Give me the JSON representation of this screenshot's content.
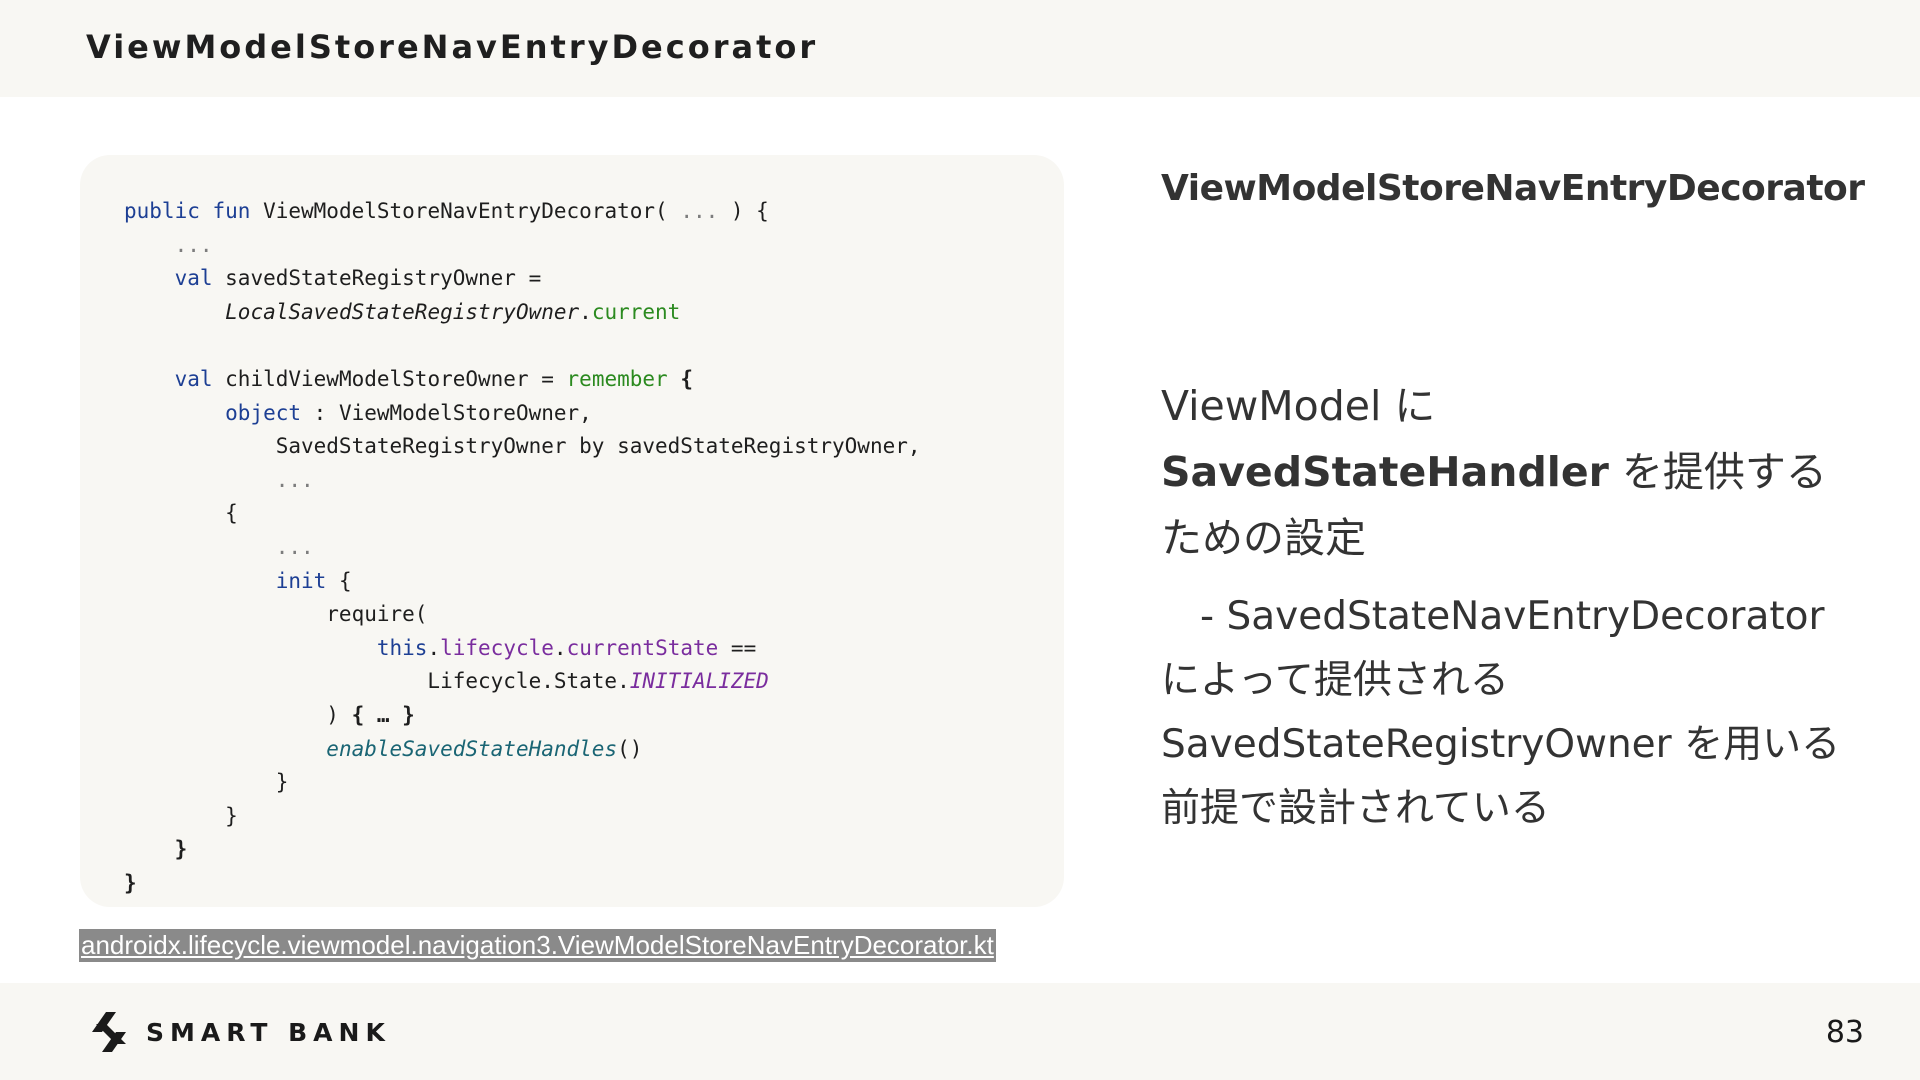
{
  "header": {
    "title": "ViewModelStoreNavEntryDecorator"
  },
  "code": {
    "lines": [
      [
        {
          "t": "public fun",
          "c": "kw"
        },
        {
          "t": " ViewModelStoreNavEntryDecorator( "
        },
        {
          "t": "...",
          "c": "gray"
        },
        {
          "t": " ) {"
        }
      ],
      [
        {
          "t": "    "
        },
        {
          "t": "...",
          "c": "gray"
        }
      ],
      [
        {
          "t": "    "
        },
        {
          "t": "val",
          "c": "kw"
        },
        {
          "t": " savedStateRegistryOwner ="
        }
      ],
      [
        {
          "t": "        "
        },
        {
          "t": "LocalSavedStateRegistryOwner",
          "c": "italic"
        },
        {
          "t": "."
        },
        {
          "t": "current",
          "c": "fn-green"
        }
      ],
      [
        {
          "t": ""
        }
      ],
      [
        {
          "t": "    "
        },
        {
          "t": "val",
          "c": "kw"
        },
        {
          "t": " childViewModelStoreOwner = "
        },
        {
          "t": "remember",
          "c": "fn-green"
        },
        {
          "t": " {",
          "c": "bold"
        }
      ],
      [
        {
          "t": "        "
        },
        {
          "t": "object",
          "c": "kw"
        },
        {
          "t": " : ViewModelStoreOwner,"
        }
      ],
      [
        {
          "t": "            SavedStateRegistryOwner by savedStateRegistryOwner,"
        }
      ],
      [
        {
          "t": "            "
        },
        {
          "t": "...",
          "c": "gray"
        }
      ],
      [
        {
          "t": "        {"
        }
      ],
      [
        {
          "t": "            "
        },
        {
          "t": "...",
          "c": "gray"
        }
      ],
      [
        {
          "t": "            "
        },
        {
          "t": "init",
          "c": "kw"
        },
        {
          "t": " {"
        }
      ],
      [
        {
          "t": "                require("
        }
      ],
      [
        {
          "t": "                    "
        },
        {
          "t": "this",
          "c": "kw"
        },
        {
          "t": "."
        },
        {
          "t": "lifecycle",
          "c": "prop"
        },
        {
          "t": "."
        },
        {
          "t": "currentState",
          "c": "prop"
        },
        {
          "t": " =="
        }
      ],
      [
        {
          "t": "                        Lifecycle.State."
        },
        {
          "t": "INITIALIZED",
          "c": "italic-violet"
        }
      ],
      [
        {
          "t": "                ) "
        },
        {
          "t": "{ … }",
          "c": "bold"
        }
      ],
      [
        {
          "t": "                "
        },
        {
          "t": "enableSavedStateHandles",
          "c": "italic-teal"
        },
        {
          "t": "()"
        }
      ],
      [
        {
          "t": "            }"
        }
      ],
      [
        {
          "t": "        }"
        }
      ],
      [
        {
          "t": "    }",
          "c": "bold"
        }
      ],
      [
        {
          "t": "}",
          "c": "bold"
        }
      ]
    ]
  },
  "caption": {
    "text": "androidx.lifecycle.viewmodel.navigation3.ViewModelStoreNavEntryDecorator.kt"
  },
  "right": {
    "heading": "ViewModelStoreNavEntryDecorator",
    "body_prefix": "ViewModel に",
    "body_strong": "SavedStateHandler",
    "body_suffix": " を提供するための設定",
    "note": "　- SavedStateNavEntryDecorator によって提供される SavedStateRegistryOwner を用いる前提で設計されている"
  },
  "footer": {
    "logo_text": "SMART BANK",
    "logo_icon": "smartbank-logo-icon",
    "page_number": "83"
  },
  "colors": {
    "keyword": "#1d3f94",
    "composable": "#2b8a1f",
    "property": "#7a2d9e",
    "teal_call": "#1a6574",
    "panel_bg": "#f8f7f3"
  }
}
